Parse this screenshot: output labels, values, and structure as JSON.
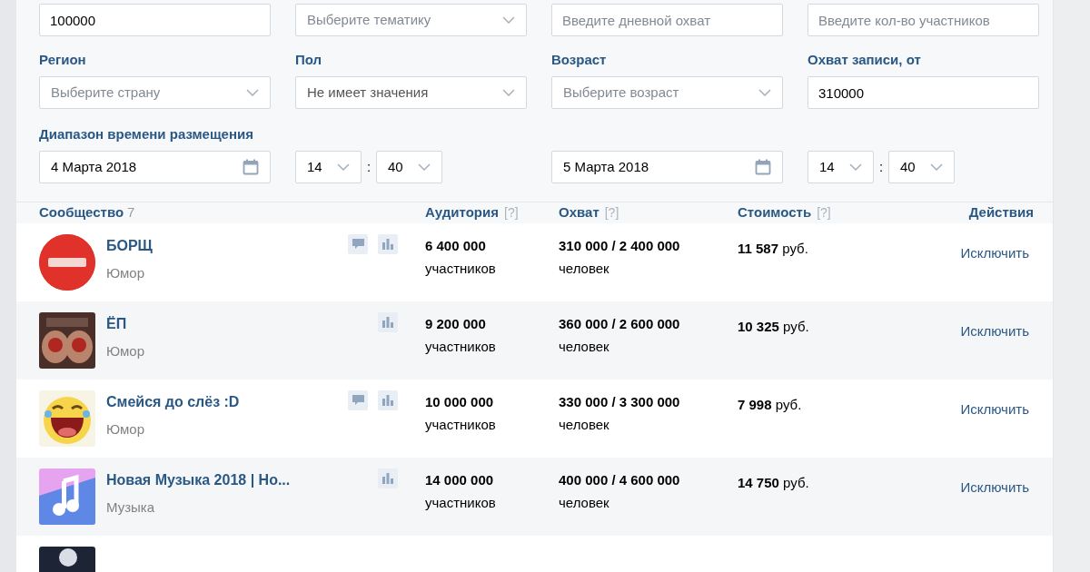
{
  "filters": {
    "rows": [
      {
        "fields": [
          {
            "kind": "input",
            "value": "100000"
          },
          {
            "kind": "select",
            "placeholder": "Выберите тематику"
          },
          {
            "kind": "input",
            "placeholder": "Введите дневной охват"
          },
          {
            "kind": "input",
            "placeholder": "Введите кол-во участников"
          }
        ]
      },
      {
        "fields": [
          {
            "kind": "select",
            "label": "Регион",
            "placeholder": "Выберите страну"
          },
          {
            "kind": "select",
            "label": "Пол",
            "value": "Не имеет значения"
          },
          {
            "kind": "select",
            "label": "Возраст",
            "placeholder": "Выберите возраст"
          },
          {
            "kind": "input",
            "label": "Охват записи, от",
            "value": "310000"
          }
        ]
      }
    ],
    "range": {
      "label": "Диапазон времени размещения",
      "ends": [
        {
          "date": "4 Марта 2018",
          "hour": "14",
          "separator": ":",
          "minute": "40"
        },
        {
          "date": "5 Марта 2018",
          "hour": "14",
          "separator": ":",
          "minute": "40"
        }
      ]
    }
  },
  "table": {
    "columns": [
      {
        "label": "Сообщество",
        "count": "7"
      },
      {
        "label": "Аудитория",
        "hint": "[?]"
      },
      {
        "label": "Охват",
        "hint": "[?]"
      },
      {
        "label": "Стоимость",
        "hint": "[?]"
      },
      {
        "label": "Действия"
      }
    ],
    "rows": [
      {
        "avatar": {
          "kind": "picture"
        },
        "name": "БОРЩ",
        "topic": "Юмор",
        "comments_button": true,
        "stats_button": true,
        "audience": "6 400 000",
        "audience_unit": "участников",
        "reach": "310 000 / 2 400 000",
        "reach_unit": "человек",
        "cost": "**11 587** руб.",
        "action": "Исключить"
      },
      {
        "avatar": {
          "kind": "picture"
        },
        "name": "ЁП",
        "topic": "Юмор",
        "comments_button": false,
        "stats_button": true,
        "audience": "9 200 000",
        "audience_unit": "участников",
        "reach": "360 000 / 2 600 000",
        "reach_unit": "человек",
        "cost": "**10 325** руб.",
        "action": "Исключить"
      },
      {
        "avatar": {
          "kind": "picture"
        },
        "name": "Смейся до слёз :D",
        "topic": "Юмор",
        "comments_button": true,
        "stats_button": true,
        "audience": "10 000 000",
        "audience_unit": "участников",
        "reach": "330 000 / 3 300 000",
        "reach_unit": "человек",
        "cost": "**7 998** руб.",
        "action": "Исключить"
      },
      {
        "avatar": {
          "kind": "picture"
        },
        "name": "Новая Музыка 2018 | Но...",
        "topic": "Музыка",
        "comments_button": false,
        "stats_button": true,
        "audience": "14 000 000",
        "audience_unit": "участников",
        "reach": "400 000 / 4 600 000",
        "reach_unit": "человек",
        "cost": "**14 750** руб.",
        "action": "Исключить"
      },
      {
        "avatar": {
          "kind": "picture"
        }
      }
    ]
  }
}
